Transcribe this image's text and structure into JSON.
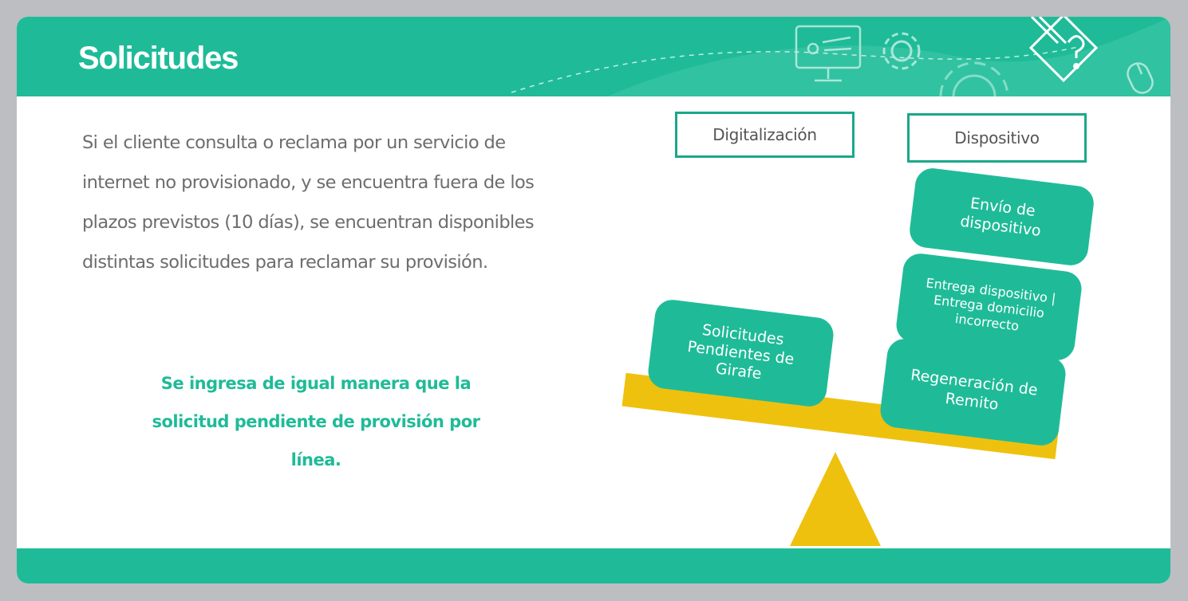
{
  "header": {
    "title": "Solicitudes"
  },
  "content": {
    "paragraph": "Si el cliente consulta o reclama por un servicio de internet no provisionado, y se encuentra fuera de los plazos previstos (10 días), se encuentran disponibles distintas solicitudes para reclamar su provisión.",
    "highlight": "Se ingresa de igual manera que la solicitud pendiente de provisión por línea."
  },
  "balance": {
    "left_label": "Digitalización",
    "right_label": "Dispositivo",
    "left_items": [
      "Solicitudes\nPendientes de\nGirafe"
    ],
    "right_items": [
      "Envío de\ndispositivo",
      "Entrega dispositivo |\nEntrega domicilio\nincorrecto",
      "Regeneración de\nRemito"
    ]
  },
  "colors": {
    "accent": "#1fbb98",
    "beam": "#efc10f",
    "text": "#6d6d6d",
    "background": "#bcbec1"
  },
  "icons": [
    "presentation-icon",
    "gear-icon",
    "large-gear-icon",
    "pencil-question-icon",
    "mouse-icon"
  ]
}
